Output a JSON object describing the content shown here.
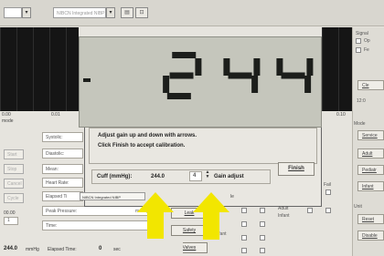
{
  "toolbar": {
    "device_select": "NIBCN Integrated NIBP"
  },
  "waveform": {
    "tick_labels": [
      "0.00",
      "0.01",
      "0.10"
    ],
    "left_label": "mode"
  },
  "vitals": {
    "systolic": "Systolic:",
    "diastolic": "Diastolic:",
    "mean": "Mean:",
    "heart_rate": "Heart Rate:",
    "elapsed": "Elapsed Ti",
    "peak_pressure": "Peak Pressure:",
    "peak_unit": "mmHg",
    "time": "Time:",
    "small_value": "00.00",
    "small_value2": "1"
  },
  "left_buttons": [
    "Start",
    "Stop",
    "Cancel",
    "Cycle"
  ],
  "status_bar": {
    "pressure_value": "244.0",
    "pressure_unit": "mmHg",
    "elapsed_label": "Elapsed Time:",
    "elapsed_value": "0",
    "elapsed_unit": "sec"
  },
  "lcd": {
    "reading": "244",
    "sign": "-"
  },
  "dialog": {
    "instruction_line1": "Adjust gain up and down with arrows.",
    "instruction_line2": "Click Finish to accept calibration.",
    "cuff_label": "Cuff (mmHg):",
    "cuff_value": "244.0",
    "gain_value": "4",
    "gain_label": "Gain adjust",
    "finish_button": "Finish",
    "device_caption": "NIBCN Integrated NIBP",
    "caption_suffix": "le"
  },
  "mid_buttons": {
    "leak": "Leak",
    "safety": "Safety",
    "valves": "Valves"
  },
  "patient": {
    "adult": "Adult",
    "infant": "Infant",
    "fail": "Fail"
  },
  "right_panel": {
    "signal_label": "Signal",
    "opt1": "Op",
    "opt2": "Fe",
    "clear": "Cle",
    "time_value": "12:0",
    "mode": "Mode",
    "service": "Service",
    "adult": "Adult",
    "pediatric": "Pediatr",
    "infant": "Infant",
    "unit": "Unit",
    "reset": "Reset ",
    "disable": "Disable "
  },
  "colors": {
    "arrow": "#f2e600",
    "lcd_bg": "#c5c6bc",
    "digits": "#1c1e1b",
    "dialog_border": "#4a63a8"
  }
}
